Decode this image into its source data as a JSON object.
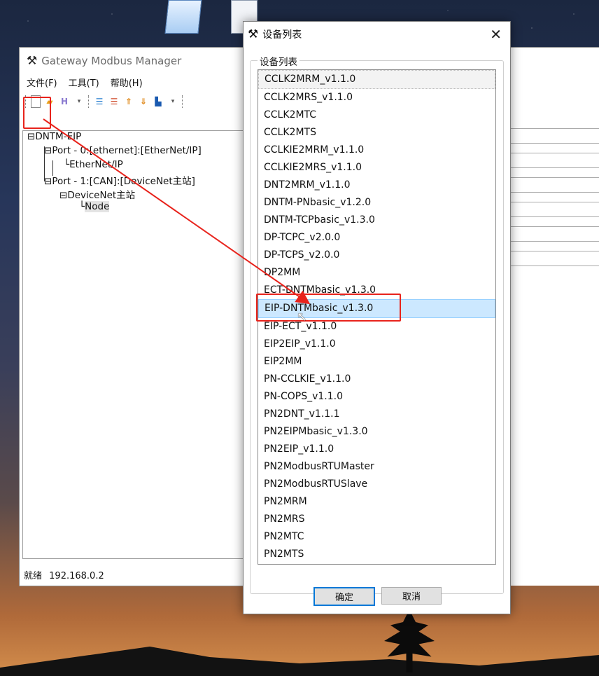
{
  "main_window": {
    "title": "Gateway Modbus Manager",
    "menu": [
      "文件(F)",
      "工具(T)",
      "帮助(H)"
    ],
    "tree": {
      "root": "DNTM-EIP",
      "port0": "Port - 0:[ethernet]:[EtherNet/IP]",
      "port0_child": "EtherNet/IP",
      "port1": "Port - 1:[CAN]:[DeviceNet主站]",
      "port1_child": "DeviceNet主站",
      "node": "Node"
    },
    "status": {
      "text": "就绪",
      "ip": "192.168.0.2"
    }
  },
  "dialog": {
    "title": "设备列表",
    "group_label": "设备列表",
    "items": [
      "CCLK2MRM_v1.1.0",
      "CCLK2MRS_v1.1.0",
      "CCLK2MTC",
      "CCLK2MTS",
      "CCLKIE2MRM_v1.1.0",
      "CCLKIE2MRS_v1.1.0",
      "DNT2MRM_v1.1.0",
      "DNTM-PNbasic_v1.2.0",
      "DNTM-TCPbasic_v1.3.0",
      "DP-TCPC_v2.0.0",
      "DP-TCPS_v2.0.0",
      "DP2MM",
      "ECT-DNTMbasic_v1.3.0",
      "EIP-DNTMbasic_v1.3.0",
      "EIP-ECT_v1.1.0",
      "EIP2EIP_v1.1.0",
      "EIP2MM",
      "PN-CCLKIE_v1.1.0",
      "PN-COPS_v1.1.0",
      "PN2DNT_v1.1.1",
      "PN2EIPMbasic_v1.3.0",
      "PN2EIP_v1.1.0",
      "PN2ModbusRTUMaster",
      "PN2ModbusRTUSlave",
      "PN2MRM",
      "PN2MRS",
      "PN2MTC",
      "PN2MTS"
    ],
    "selected_index": 13,
    "ok_label": "确定",
    "cancel_label": "取消"
  },
  "desktop": {
    "icon_labels": [
      "",
      ""
    ]
  },
  "colors": {
    "highlight": "#e8231c",
    "selection": "#cce8ff"
  },
  "icons": {
    "app": "hammer-wrench-icon",
    "close": "close-icon",
    "new": "new-file-icon"
  }
}
